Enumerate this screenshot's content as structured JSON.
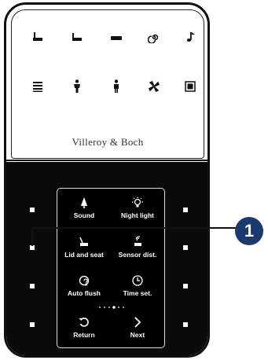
{
  "brand": "Villeroy & Boch",
  "top_icons": {
    "row1": [
      "seat-open-icon",
      "seat-closed-icon",
      "lid-icon",
      "spiral-icon",
      "music-note-icon"
    ],
    "row2": [
      "heat-icon",
      "person-icon",
      "person-icon",
      "fan-icon",
      "square-icon"
    ]
  },
  "menu": {
    "sound": "Sound",
    "night_light": "Night light",
    "lid_and_seat": "Lid and seat",
    "sensor_dist": "Sensor dist.",
    "auto_flush": "Auto flush",
    "time_set": "Time set.",
    "return": "Return",
    "next": "Next"
  },
  "callout": "1",
  "colors": {
    "panel": "#0a0a0a",
    "callout": "#1d3a6e"
  }
}
